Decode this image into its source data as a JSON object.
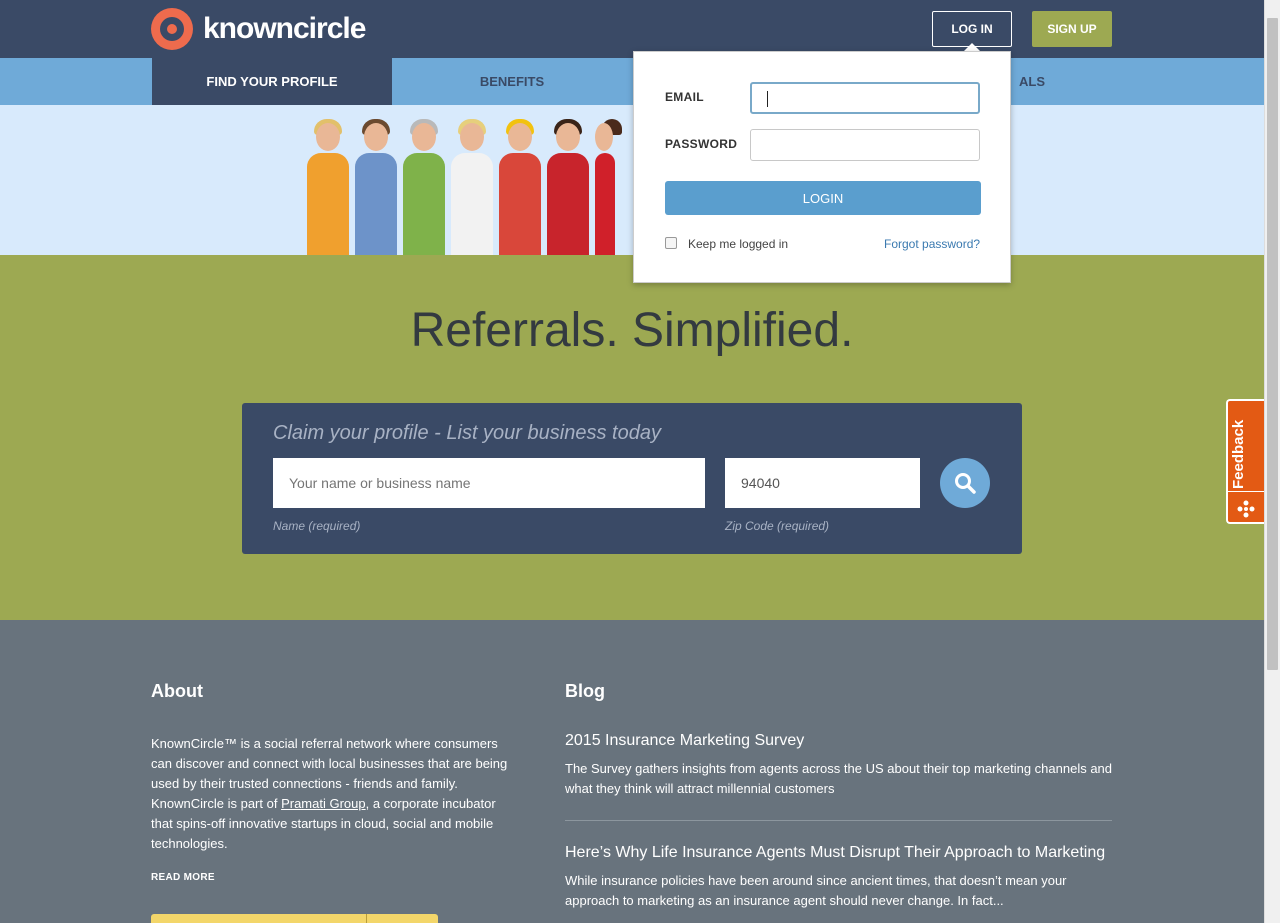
{
  "brand": {
    "name": "knowncircle"
  },
  "header": {
    "login_label": "LOG IN",
    "signup_label": "SIGN UP"
  },
  "nav": {
    "items": [
      {
        "label": "FIND YOUR PROFILE"
      },
      {
        "label": "BENEFITS"
      },
      {
        "label": ""
      },
      {
        "label": "ALS"
      }
    ]
  },
  "hero": {
    "headline": "Referrals. Simplified."
  },
  "claim": {
    "title": "Claim your profile - List your business today",
    "name_placeholder": "Your name or business name",
    "zip_value": "94040",
    "name_label": "Name (required)",
    "zip_label": "Zip Code (required)"
  },
  "about": {
    "heading": "About",
    "text_before": "KnownCircle™ is a social referral network where consumers can discover and connect with local businesses that are being used by their trusted connections - friends and family. KnownCircle is part of ",
    "link": "Pramati Group",
    "text_after": ", a corporate incubator that spins-off innovative startups in cloud, social and mobile technologies.",
    "read_more": "READ MORE"
  },
  "blog": {
    "heading": "Blog",
    "posts": [
      {
        "title": "2015 Insurance Marketing Survey",
        "excerpt": "The Survey gathers insights from agents across the US about their top marketing channels and what they think will attract millennial customers"
      },
      {
        "title": "Here’s Why Life Insurance Agents Must Disrupt Their Approach to Marketing",
        "excerpt": "While insurance policies have been around since ancient times, that doesn’t mean your approach to marketing as an insurance agent should never change. In fact..."
      }
    ]
  },
  "login_dropdown": {
    "email_label": "EMAIL",
    "password_label": "PASSWORD",
    "email_value": "",
    "password_value": "",
    "submit_label": "LOGIN",
    "remember_label": "Keep me logged in",
    "forgot_label": "Forgot password?"
  },
  "feedback": {
    "label": "Feedback"
  },
  "colors": {
    "header_bg": "#3a4a66",
    "nav_bg": "#6faad8",
    "accent_green": "#9da952",
    "logo_orange": "#ee6b4d",
    "footer_bg": "#68737d",
    "feedback_orange": "#e35a14"
  }
}
